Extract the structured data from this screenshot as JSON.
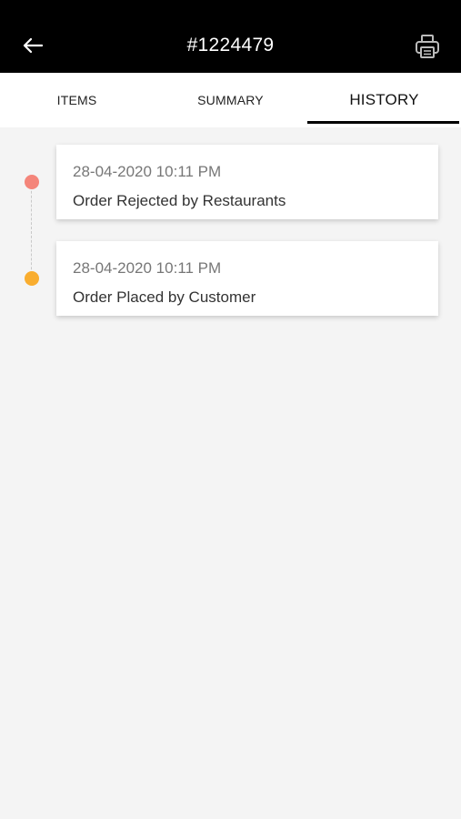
{
  "header": {
    "title": "#1224479",
    "back_icon": "arrow-left-icon",
    "print_icon": "printer-icon",
    "background": "#000000"
  },
  "tabs": [
    {
      "label": "ITEMS",
      "active": false
    },
    {
      "label": "SUMMARY",
      "active": false
    },
    {
      "label": "HISTORY",
      "active": true
    }
  ],
  "history": [
    {
      "timestamp": "28-04-2020 10:11 PM",
      "status": "Order Rejected by Restaurants",
      "dot_color": "#f4857a"
    },
    {
      "timestamp": "28-04-2020 10:11 PM",
      "status": "Order Placed by Customer",
      "dot_color": "#f9ad2f"
    }
  ]
}
